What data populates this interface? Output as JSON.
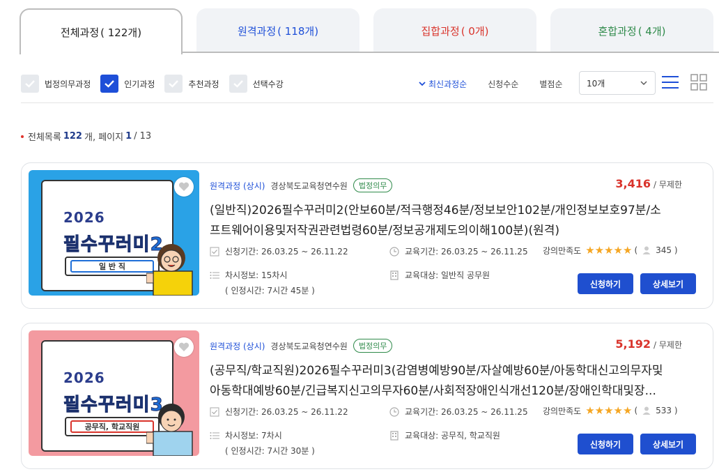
{
  "tabs": [
    {
      "label": "전체과정",
      "count": "( 122개)",
      "color": "#222222",
      "active": true
    },
    {
      "label": "원격과정",
      "count": "( 118개)",
      "color": "#1e4fd8",
      "active": false
    },
    {
      "label": "집합과정",
      "count": "( 0개)",
      "color": "#d9332b",
      "active": false
    },
    {
      "label": "혼합과정",
      "count": "( 4개)",
      "color": "#2f8a4a",
      "active": false
    }
  ],
  "filters": [
    {
      "label": "법정의무과정",
      "checked": false
    },
    {
      "label": "인기과정",
      "checked": true
    },
    {
      "label": "추천과정",
      "checked": false
    },
    {
      "label": "선택수강",
      "checked": false
    }
  ],
  "sorts": [
    "최신과정순",
    "신청수순",
    "별점순"
  ],
  "page_size": "10개",
  "summary": {
    "prefix": "전체목록",
    "total": "122",
    "mid": "개, 페이지",
    "page": "1",
    "pages": "/ 13"
  },
  "courses": [
    {
      "thumb": {
        "year": "2026",
        "title": "필수꾸러미2",
        "tag": "일 반 직",
        "bg": "#2aa2e6",
        "tag_color": "#1e6fd8"
      },
      "type": "원격과정 (상시)",
      "org": "경상북도교육청연수원",
      "badge": "법정의무",
      "price": "3,416",
      "price_unit": "/ 무제한",
      "title_line1": "(일반직)2026필수꾸러미2(안보60분/적극행정46분/정보보안102분/개인정보보호97분/소",
      "title_line2": "프트웨어이용및저작권관련법령60분/정보공개제도의이해100분)(원격)",
      "apply_period": "신청기간: 26.03.25 ~ 26.11.22",
      "edu_period": "교육기간: 26.03.25 ~ 26.11.25",
      "rating_label": "강의만족도",
      "stars": "★★★★★",
      "rating_open": "(",
      "rating_count": "345 )",
      "sessions": "차시정보: 15차시",
      "hours": "( 인정시간: 7시간 45분 )",
      "target": "교육대상: 일반직 공무원",
      "apply_btn": "신청하기",
      "detail_btn": "상세보기"
    },
    {
      "thumb": {
        "year": "2026",
        "title": "필수꾸러미3",
        "tag": "공무직, 학교직원",
        "bg": "#f39aa0",
        "tag_color": "#d9332b"
      },
      "type": "원격과정 (상시)",
      "org": "경상북도교육청연수원",
      "badge": "법정의무",
      "price": "5,192",
      "price_unit": "/ 무제한",
      "title_line1": "(공무직/학교직원)2026필수꾸러미3(감염병예방90분/자살예방60분/아동학대신고의무자및",
      "title_line2": "아동학대예방60분/긴급복지신고의무자60분/사회적장애인식개선120분/장애인학대및장...",
      "apply_period": "신청기간: 26.03.25 ~ 26.11.22",
      "edu_period": "교육기간: 26.03.25 ~ 26.11.25",
      "rating_label": "강의만족도",
      "stars": "★★★★★",
      "rating_open": "(",
      "rating_count": "533 )",
      "sessions": "차시정보: 7차시",
      "hours": "( 인정시간: 7시간 30분 )",
      "target": "교육대상: 공무직, 학교직원",
      "apply_btn": "신청하기",
      "detail_btn": "상세보기"
    }
  ]
}
